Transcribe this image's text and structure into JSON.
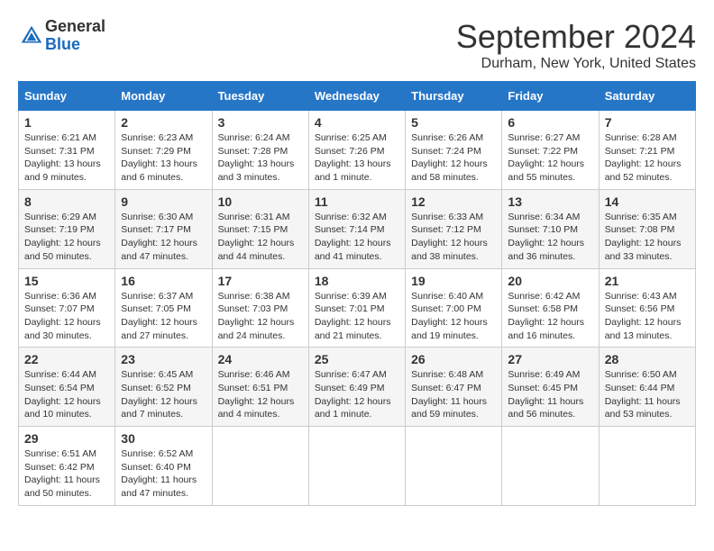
{
  "header": {
    "logo_text_top": "General",
    "logo_text_bottom": "Blue",
    "month": "September 2024",
    "location": "Durham, New York, United States"
  },
  "weekdays": [
    "Sunday",
    "Monday",
    "Tuesday",
    "Wednesday",
    "Thursday",
    "Friday",
    "Saturday"
  ],
  "weeks": [
    [
      {
        "day": "1",
        "sunrise": "Sunrise: 6:21 AM",
        "sunset": "Sunset: 7:31 PM",
        "daylight": "Daylight: 13 hours and 9 minutes."
      },
      {
        "day": "2",
        "sunrise": "Sunrise: 6:23 AM",
        "sunset": "Sunset: 7:29 PM",
        "daylight": "Daylight: 13 hours and 6 minutes."
      },
      {
        "day": "3",
        "sunrise": "Sunrise: 6:24 AM",
        "sunset": "Sunset: 7:28 PM",
        "daylight": "Daylight: 13 hours and 3 minutes."
      },
      {
        "day": "4",
        "sunrise": "Sunrise: 6:25 AM",
        "sunset": "Sunset: 7:26 PM",
        "daylight": "Daylight: 13 hours and 1 minute."
      },
      {
        "day": "5",
        "sunrise": "Sunrise: 6:26 AM",
        "sunset": "Sunset: 7:24 PM",
        "daylight": "Daylight: 12 hours and 58 minutes."
      },
      {
        "day": "6",
        "sunrise": "Sunrise: 6:27 AM",
        "sunset": "Sunset: 7:22 PM",
        "daylight": "Daylight: 12 hours and 55 minutes."
      },
      {
        "day": "7",
        "sunrise": "Sunrise: 6:28 AM",
        "sunset": "Sunset: 7:21 PM",
        "daylight": "Daylight: 12 hours and 52 minutes."
      }
    ],
    [
      {
        "day": "8",
        "sunrise": "Sunrise: 6:29 AM",
        "sunset": "Sunset: 7:19 PM",
        "daylight": "Daylight: 12 hours and 50 minutes."
      },
      {
        "day": "9",
        "sunrise": "Sunrise: 6:30 AM",
        "sunset": "Sunset: 7:17 PM",
        "daylight": "Daylight: 12 hours and 47 minutes."
      },
      {
        "day": "10",
        "sunrise": "Sunrise: 6:31 AM",
        "sunset": "Sunset: 7:15 PM",
        "daylight": "Daylight: 12 hours and 44 minutes."
      },
      {
        "day": "11",
        "sunrise": "Sunrise: 6:32 AM",
        "sunset": "Sunset: 7:14 PM",
        "daylight": "Daylight: 12 hours and 41 minutes."
      },
      {
        "day": "12",
        "sunrise": "Sunrise: 6:33 AM",
        "sunset": "Sunset: 7:12 PM",
        "daylight": "Daylight: 12 hours and 38 minutes."
      },
      {
        "day": "13",
        "sunrise": "Sunrise: 6:34 AM",
        "sunset": "Sunset: 7:10 PM",
        "daylight": "Daylight: 12 hours and 36 minutes."
      },
      {
        "day": "14",
        "sunrise": "Sunrise: 6:35 AM",
        "sunset": "Sunset: 7:08 PM",
        "daylight": "Daylight: 12 hours and 33 minutes."
      }
    ],
    [
      {
        "day": "15",
        "sunrise": "Sunrise: 6:36 AM",
        "sunset": "Sunset: 7:07 PM",
        "daylight": "Daylight: 12 hours and 30 minutes."
      },
      {
        "day": "16",
        "sunrise": "Sunrise: 6:37 AM",
        "sunset": "Sunset: 7:05 PM",
        "daylight": "Daylight: 12 hours and 27 minutes."
      },
      {
        "day": "17",
        "sunrise": "Sunrise: 6:38 AM",
        "sunset": "Sunset: 7:03 PM",
        "daylight": "Daylight: 12 hours and 24 minutes."
      },
      {
        "day": "18",
        "sunrise": "Sunrise: 6:39 AM",
        "sunset": "Sunset: 7:01 PM",
        "daylight": "Daylight: 12 hours and 21 minutes."
      },
      {
        "day": "19",
        "sunrise": "Sunrise: 6:40 AM",
        "sunset": "Sunset: 7:00 PM",
        "daylight": "Daylight: 12 hours and 19 minutes."
      },
      {
        "day": "20",
        "sunrise": "Sunrise: 6:42 AM",
        "sunset": "Sunset: 6:58 PM",
        "daylight": "Daylight: 12 hours and 16 minutes."
      },
      {
        "day": "21",
        "sunrise": "Sunrise: 6:43 AM",
        "sunset": "Sunset: 6:56 PM",
        "daylight": "Daylight: 12 hours and 13 minutes."
      }
    ],
    [
      {
        "day": "22",
        "sunrise": "Sunrise: 6:44 AM",
        "sunset": "Sunset: 6:54 PM",
        "daylight": "Daylight: 12 hours and 10 minutes."
      },
      {
        "day": "23",
        "sunrise": "Sunrise: 6:45 AM",
        "sunset": "Sunset: 6:52 PM",
        "daylight": "Daylight: 12 hours and 7 minutes."
      },
      {
        "day": "24",
        "sunrise": "Sunrise: 6:46 AM",
        "sunset": "Sunset: 6:51 PM",
        "daylight": "Daylight: 12 hours and 4 minutes."
      },
      {
        "day": "25",
        "sunrise": "Sunrise: 6:47 AM",
        "sunset": "Sunset: 6:49 PM",
        "daylight": "Daylight: 12 hours and 1 minute."
      },
      {
        "day": "26",
        "sunrise": "Sunrise: 6:48 AM",
        "sunset": "Sunset: 6:47 PM",
        "daylight": "Daylight: 11 hours and 59 minutes."
      },
      {
        "day": "27",
        "sunrise": "Sunrise: 6:49 AM",
        "sunset": "Sunset: 6:45 PM",
        "daylight": "Daylight: 11 hours and 56 minutes."
      },
      {
        "day": "28",
        "sunrise": "Sunrise: 6:50 AM",
        "sunset": "Sunset: 6:44 PM",
        "daylight": "Daylight: 11 hours and 53 minutes."
      }
    ],
    [
      {
        "day": "29",
        "sunrise": "Sunrise: 6:51 AM",
        "sunset": "Sunset: 6:42 PM",
        "daylight": "Daylight: 11 hours and 50 minutes."
      },
      {
        "day": "30",
        "sunrise": "Sunrise: 6:52 AM",
        "sunset": "Sunset: 6:40 PM",
        "daylight": "Daylight: 11 hours and 47 minutes."
      },
      null,
      null,
      null,
      null,
      null
    ]
  ]
}
